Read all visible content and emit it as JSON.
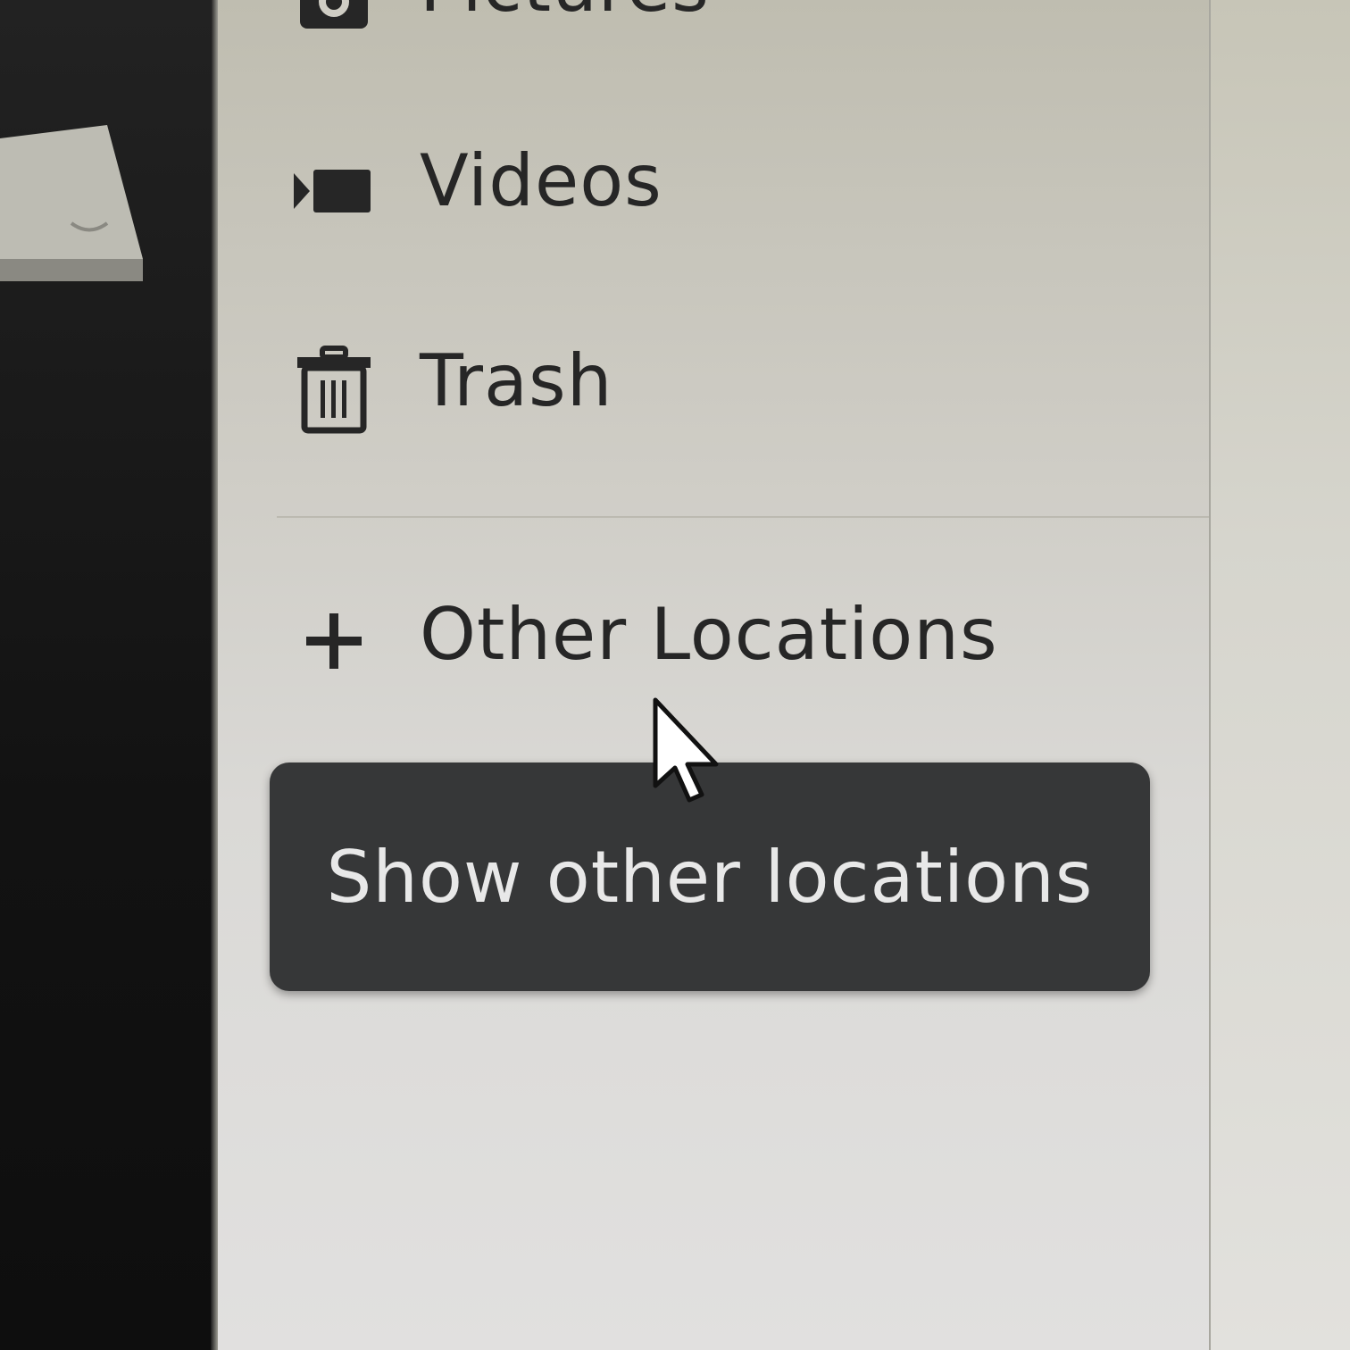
{
  "sidebar": {
    "items": [
      {
        "label": "Pictures",
        "icon": "camera-icon"
      },
      {
        "label": "Videos",
        "icon": "video-camera-icon"
      },
      {
        "label": "Trash",
        "icon": "trash-icon"
      },
      {
        "label": "Other Locations",
        "icon": "plus-icon"
      }
    ]
  },
  "tooltip": {
    "text": "Show other locations"
  },
  "colors": {
    "sidebar_bg": "#d6d5cf",
    "text": "#262626",
    "tooltip_bg": "#363738",
    "tooltip_text": "#e8e8e8"
  }
}
